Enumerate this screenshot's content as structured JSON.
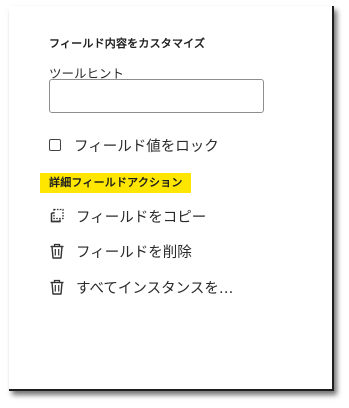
{
  "panel": {
    "section_title": "フィールド内容をカスタマイズ",
    "tooltip": {
      "label": "ツールヒント",
      "value": "",
      "placeholder": ""
    },
    "lock_field": {
      "label": "フィールド値をロック",
      "checked": false
    },
    "advanced": {
      "title": "詳細フィールドアクション",
      "highlight_color": "#ffe600",
      "actions": [
        {
          "label": "フィールドをコピー",
          "icon": "copy-icon"
        },
        {
          "label": "フィールドを削除",
          "icon": "trash-icon"
        },
        {
          "label": "すべてインスタンスを…",
          "icon": "trash-icon"
        }
      ]
    }
  }
}
